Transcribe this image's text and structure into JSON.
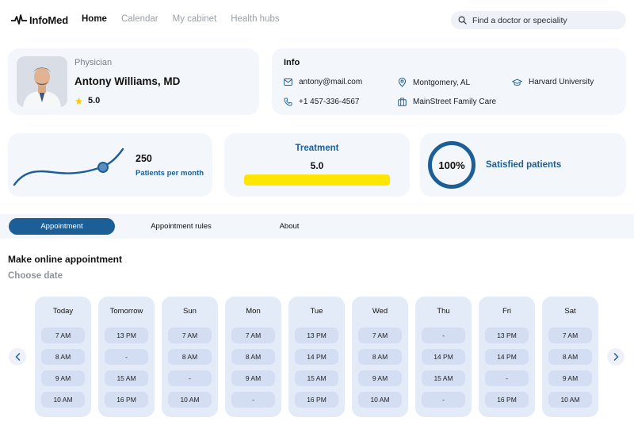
{
  "brand": {
    "name": "InfoMed",
    "logo_icon": "pulse-icon"
  },
  "nav": {
    "items": [
      {
        "label": "Home",
        "active": true
      },
      {
        "label": "Calendar",
        "active": false
      },
      {
        "label": "My cabinet",
        "active": false
      },
      {
        "label": "Health hubs",
        "active": false
      }
    ]
  },
  "search": {
    "placeholder": "Find a doctor or speciality",
    "icon": "search-icon"
  },
  "profile": {
    "role": "Physician",
    "name": "Antony Williams, MD",
    "rating": "5.0",
    "rating_icon": "star-icon",
    "star_color": "#ffcc00"
  },
  "info": {
    "title": "Info",
    "email": "antony@mail.com",
    "phone": "+1 457-336-4567",
    "location": "Montgomery, AL",
    "clinic": "MainStreet Family Care",
    "university": "Harvard University"
  },
  "stats": {
    "patients": {
      "value": "250",
      "label": "Patients per month"
    },
    "treatment": {
      "title": "Treatment",
      "value": "5.0",
      "fill": 1.0,
      "bar_color": "#ffe600"
    },
    "satisfaction": {
      "percent": "100%",
      "label": "Satisfied patients"
    }
  },
  "tabs": {
    "items": [
      {
        "label": "Appointment",
        "active": true
      },
      {
        "label": "Appointment rules",
        "active": false
      },
      {
        "label": "About",
        "active": false
      }
    ]
  },
  "appointment": {
    "heading": "Make online appointment",
    "subheading": "Choose date",
    "days": [
      {
        "name": "Today",
        "slots": [
          "7 AM",
          "8 AM",
          "9 AM",
          "10 AM"
        ]
      },
      {
        "name": "Tomorrow",
        "slots": [
          "13 PM",
          "-",
          "15 AM",
          "16 PM"
        ]
      },
      {
        "name": "Sun",
        "slots": [
          "7 AM",
          "8 AM",
          "-",
          "10 AM"
        ]
      },
      {
        "name": "Mon",
        "slots": [
          "7 AM",
          "8 AM",
          "9 AM",
          "-"
        ]
      },
      {
        "name": "Tue",
        "slots": [
          "13 PM",
          "14 PM",
          "15 AM",
          "16 PM"
        ]
      },
      {
        "name": "Wed",
        "slots": [
          "7 AM",
          "8 AM",
          "9 AM",
          "10 AM"
        ]
      },
      {
        "name": "Thu",
        "slots": [
          "-",
          "14 PM",
          "15 AM",
          "-"
        ]
      },
      {
        "name": "Fri",
        "slots": [
          "13 PM",
          "14 PM",
          "-",
          "16 PM"
        ]
      },
      {
        "name": "Sat",
        "slots": [
          "7 AM",
          "8 AM",
          "9 AM",
          "10 AM"
        ]
      }
    ]
  },
  "colors": {
    "accent": "#1c5f97",
    "card_bg": "#f3f6fb",
    "slot_bg": "#d3def3",
    "day_bg": "#e4ebf8"
  }
}
